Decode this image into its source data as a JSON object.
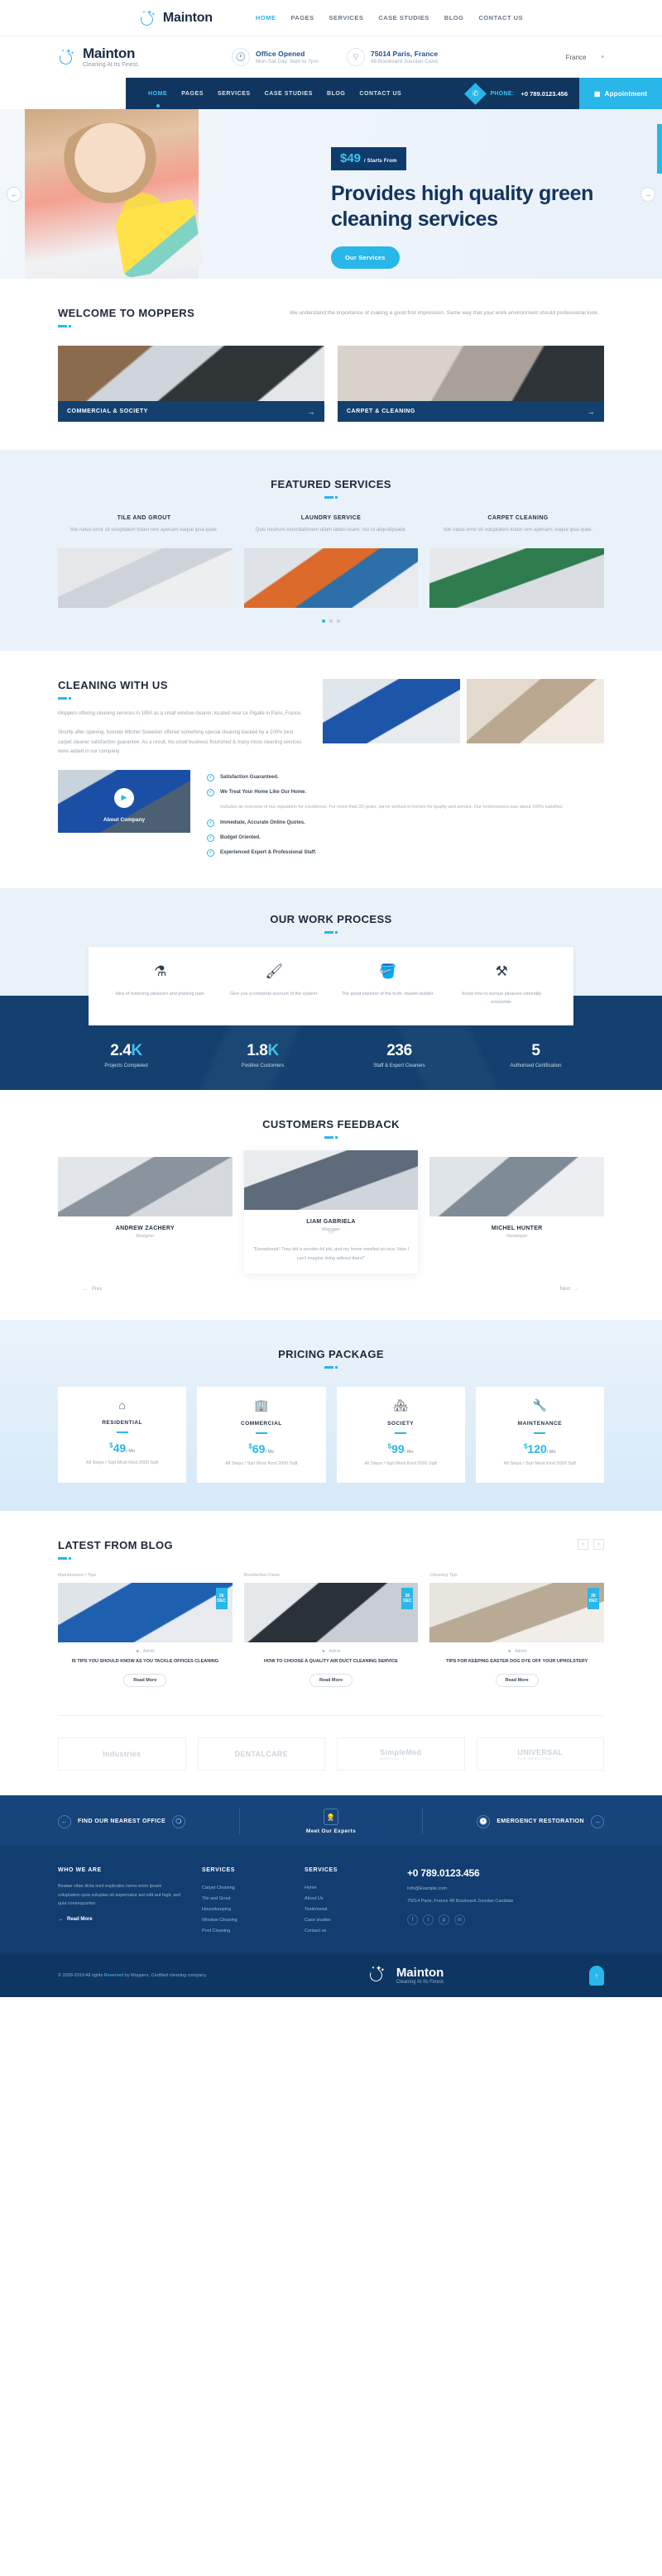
{
  "brand": {
    "name": "Mainton",
    "tagline": "Cleaning At Its Finest."
  },
  "topnav": {
    "links": [
      "HOME",
      "PAGES",
      "SERVICES",
      "CASE STUDIES",
      "BLOG",
      "CONTACT US"
    ]
  },
  "infobar": {
    "office": {
      "title": "Office Opened",
      "sub": "Mon-Sat Day: 9am to 7pm",
      "icon": "clock-icon"
    },
    "address": {
      "title": "75014 Paris, France",
      "sub": "48 Boulevard Jourdan Cand",
      "icon": "location-icon"
    },
    "language": "France"
  },
  "mainnav": {
    "links": [
      "HOME",
      "PAGES",
      "SERVICES",
      "CASE STUDIES",
      "BLOG",
      "CONTACT US"
    ],
    "phone_label": "PHONE:",
    "phone_number": "+0 789.0123.456",
    "appointment": "Appointment"
  },
  "hero": {
    "price": "$49",
    "price_note": "/ Starts From",
    "heading": "Provides high quality green cleaning services",
    "cta": "Our Services"
  },
  "welcome": {
    "title": "WELCOME TO MOPPERS",
    "desc": "We understand the importance of making a good first impression. Same way that your work environment should professional look.",
    "cards": [
      {
        "label": "COMMERCIAL & SOCIETY"
      },
      {
        "label": "CARPET & CLEANING"
      }
    ]
  },
  "featured": {
    "title": "FEATURED SERVICES",
    "items": [
      {
        "title": "TILE AND GROUT",
        "desc": "Iste natus error sit voluptatem totam rem aperiam eaque ipsa quae."
      },
      {
        "title": "LAUNDRY SERVICE",
        "desc": "Quis nostrum exercitationem ullam labori-osam, nisi ut aliquidipsalur."
      },
      {
        "title": "CARPET CLEANING",
        "desc": "Iste natus error sit voluptatem totam rem aperiam, eaque ipsa quae."
      }
    ]
  },
  "cleaning": {
    "title": "CLEANING WITH US",
    "p1": "Moppers offering cleaning services in 1950 as a small window cleaner, located near Le Pigalle in Paris, France.",
    "p2": "Shortly after opening, founder Mitchel Sweedon offered something special cleaning backed by a 100% best carpet cleaner satisfaction guarantee. As a result, his small business flourished & many more cleaning services were added in our company.",
    "video_caption": "About Company",
    "features": [
      "Satisfaction Guaranteed.",
      "We Treat Your Home Like Our Home.",
      "Includes an overview of our reputation for excellence. For more than 20 years, we've worked in homes for quality and service. Our homeowners saw about 100% satisfied.",
      "Immediate, Accurate Online Quotes.",
      "Budget Oriented.",
      "Experienced Expert & Professional Staff."
    ]
  },
  "process": {
    "title": "OUR WORK PROCESS",
    "steps": [
      {
        "icon": "spray-bottle-icon",
        "glyph": "⚗",
        "desc": "Idea of removing pleasure and praising pain."
      },
      {
        "icon": "brush-icon",
        "glyph": "🖌",
        "desc": "Give you a complete account of the system."
      },
      {
        "icon": "bucket-icon",
        "glyph": "🪣",
        "desc": "The great explorer of the truth, master-builder."
      },
      {
        "icon": "tools-icon",
        "glyph": "⚒",
        "desc": "Know how to pursue pleasure rationally encounter."
      }
    ],
    "stats": [
      {
        "value": "2.4",
        "unit": "K",
        "label": "Projects Completed"
      },
      {
        "value": "1.8",
        "unit": "K",
        "label": "Positive Customers"
      },
      {
        "value": "236",
        "unit": "",
        "label": "Staff & Expert Cleaners"
      },
      {
        "value": "5",
        "unit": "",
        "label": "Authorised Certification"
      }
    ]
  },
  "testimonials": {
    "title": "CUSTOMERS FEEDBACK",
    "items": [
      {
        "name": "ANDREW ZACHERY",
        "role": "Designer",
        "text": ""
      },
      {
        "name": "LIAM GABRIELA",
        "role": "Manager",
        "text": "\"Exceptional! They did a wonder-ful job, and my home smelled so nice. Now I can't imagine living without them!\""
      },
      {
        "name": "MICHEL HUNTER",
        "role": "Developer",
        "text": ""
      }
    ],
    "prev": "Prev",
    "next": "Next"
  },
  "pricing": {
    "title": "PRICING PACKAGE",
    "plans": [
      {
        "icon": "home-icon",
        "glyph": "⌂",
        "name": "RESIDENTIAL",
        "currency": "$",
        "price": "49",
        "per": "/ Mo",
        "desc": "All Steps / Sqrt Most Kind 2000 Sqft"
      },
      {
        "icon": "building-icon",
        "glyph": "🏢",
        "name": "COMMERCIAL",
        "currency": "$",
        "price": "69",
        "per": "/ Mo",
        "desc": "All Steps / Sqrt Most Kind 2000 Sqft"
      },
      {
        "icon": "society-icon",
        "glyph": "🏘",
        "name": "SOCIETY",
        "currency": "$",
        "price": "99",
        "per": "/ Mo",
        "desc": "All Steps / Sqrt Most Kind 2000 Sqft"
      },
      {
        "icon": "wrench-icon",
        "glyph": "🔧",
        "name": "MAINTENANCE",
        "currency": "$",
        "price": "120",
        "per": "/ Mo",
        "desc": "All Steps / Sqrt Most Kind 2000 Sqft"
      }
    ]
  },
  "blog": {
    "title": "LATEST FROM BLOG",
    "posts": [
      {
        "category": "Maintenance / Tips",
        "day": "26",
        "month": "DEC",
        "author": "Admin",
        "title": "IS TIPS YOU SHOULD KNOW AS YOU TACKLE OFFICES CLEANING",
        "button": "Read More"
      },
      {
        "category": "Residential Clean",
        "day": "26",
        "month": "DEC",
        "author": "Admin",
        "title": "HOW TO CHOOSE A QUALITY AIR DUCT CLEANING SERVICE",
        "button": "Read More"
      },
      {
        "category": "Cleaning Tips",
        "day": "26",
        "month": "DEC",
        "author": "Admin",
        "title": "TIPS FOR KEEPING EASTER DOG DYE OFF YOUR UPHOLSTERY",
        "button": "Read More"
      }
    ]
  },
  "clients": [
    {
      "name": "Industries",
      "sub": ""
    },
    {
      "name": "DENTALCARE",
      "sub": ""
    },
    {
      "name": "SimpleMed",
      "sub": "MEDICAL"
    },
    {
      "name": "UNIVERSAL",
      "sub": "THE SERVICES"
    }
  ],
  "footer": {
    "top": {
      "left": "FIND OUR NEAREST OFFICE",
      "middle": "Meet Our Experts",
      "right": "EMERGENCY RESTORATION"
    },
    "who": {
      "heading": "WHO WE ARE",
      "text": "Beatae vitae dicta sunt explicabo nemo enim ipsam voluptatem quia voluptas sit aspernatur aut odit aut fugit, sed quia consequuntur.",
      "readmore": "Read More"
    },
    "services1": {
      "heading": "SERVICES",
      "items": [
        "Carpet Cleaning",
        "Tile and Grout",
        "Housekeeping",
        "Window Cleaning",
        "Pool Cleaning"
      ]
    },
    "services2": {
      "heading": "SERVICES",
      "items": [
        "Home",
        "About Us",
        "Testimonial",
        "Case studies",
        "Contact us"
      ]
    },
    "contact": {
      "phone": "+0 789.0123.456",
      "email": "Info@Example.com",
      "address": "75014 Paris, France 48 Boulevard Jourdan Candiate",
      "socials": [
        "f",
        "t",
        "p",
        "in"
      ]
    },
    "copyright_pre": "© 2009-2019 All rights ",
    "copyright_link": "Reserved",
    "copyright_post": " by Moppers, Certified cleaning company."
  }
}
